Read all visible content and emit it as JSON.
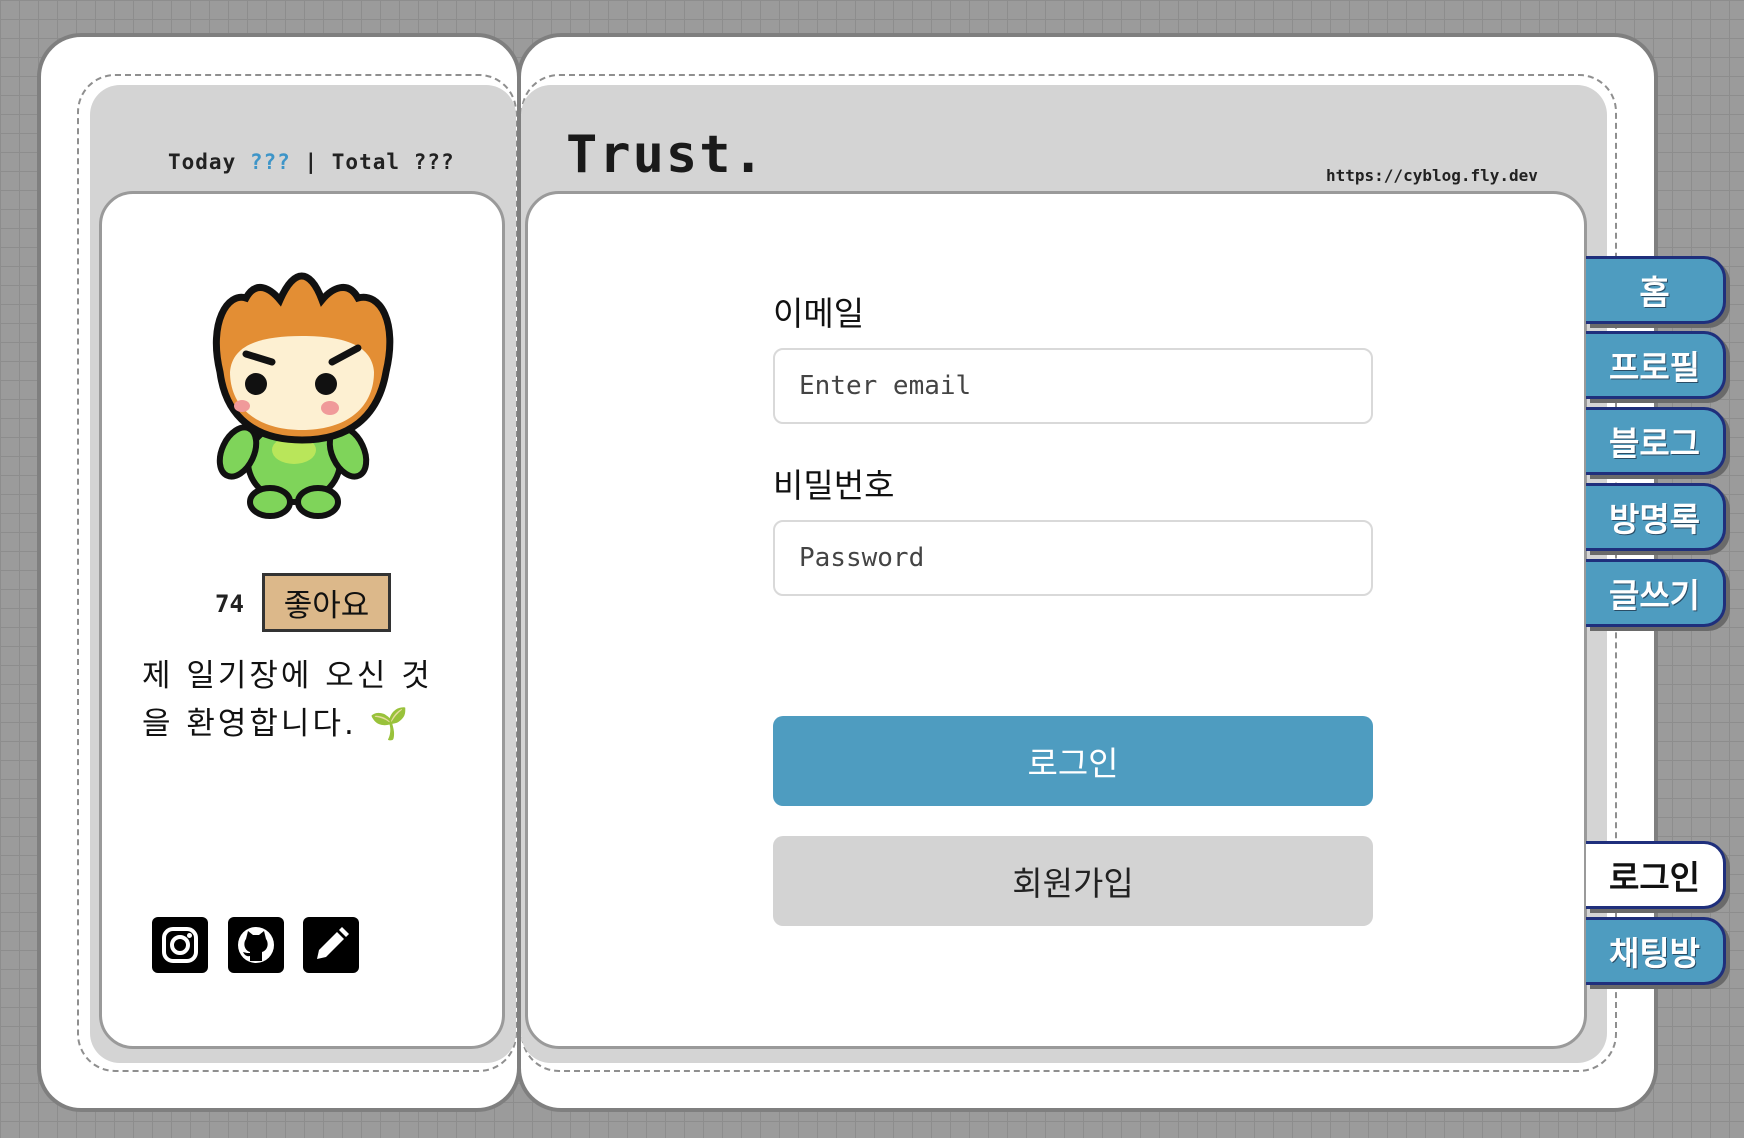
{
  "header": {
    "today_label": "Today",
    "today_value": "???",
    "separator": "|",
    "total_label": "Total",
    "total_value": "???",
    "title": "Trust.",
    "url": "https://cyblog.fly.dev"
  },
  "profile": {
    "like_count": "74",
    "like_button": "좋아요",
    "welcome_line1": "제 일기장에 오신 것",
    "welcome_line2": "을 환영합니다.",
    "welcome_emoji": "🌱",
    "social_icons": [
      "instagram-icon",
      "github-icon",
      "pencil-icon"
    ]
  },
  "login_form": {
    "email_label": "이메일",
    "email_placeholder": "Enter email",
    "email_value": "",
    "password_label": "비밀번호",
    "password_placeholder": "Password",
    "password_value": "",
    "login_button": "로그인",
    "signup_button": "회원가입"
  },
  "tabs": [
    {
      "label": "홈",
      "active": false
    },
    {
      "label": "프로필",
      "active": false
    },
    {
      "label": "블로그",
      "active": false
    },
    {
      "label": "방명록",
      "active": false
    },
    {
      "label": "글쓰기",
      "active": false
    },
    {
      "label": "로그인",
      "active": true
    },
    {
      "label": "채팅방",
      "active": false
    }
  ],
  "colors": {
    "accent": "#4e9cc0",
    "like_button": "#dcb88a",
    "counter_highlight": "#3e95c8",
    "tab_border": "#1f2f7c"
  }
}
